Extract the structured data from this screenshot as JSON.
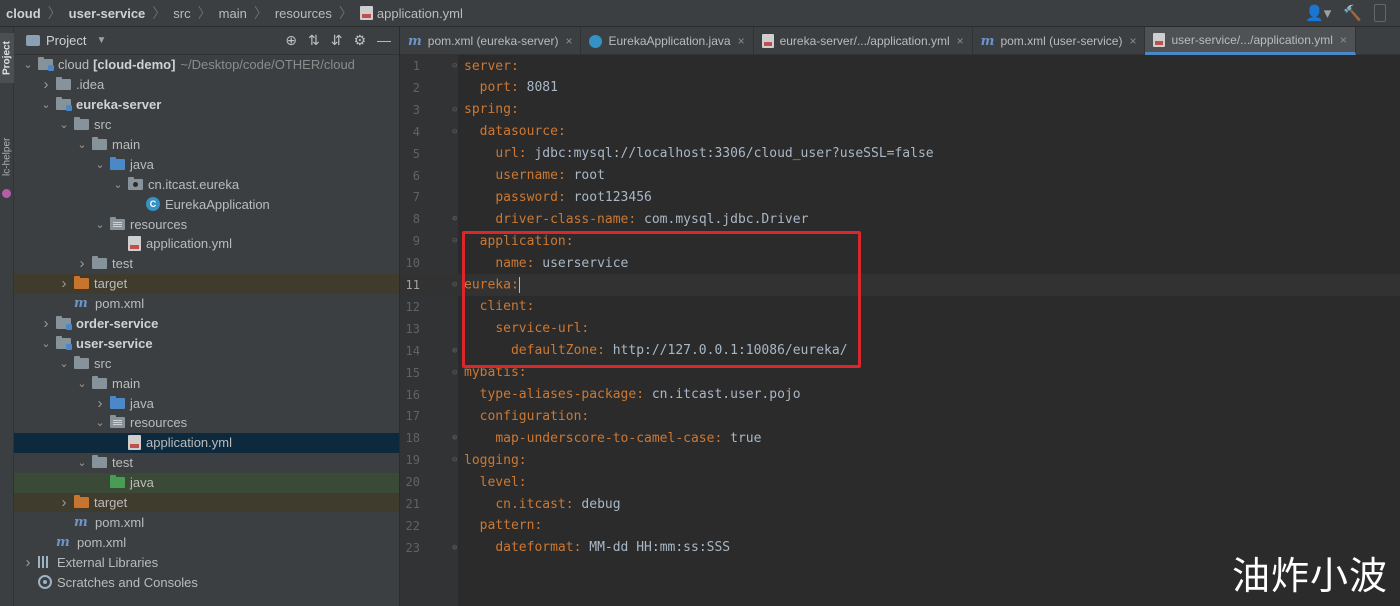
{
  "breadcrumb": [
    "cloud",
    "user-service",
    "src",
    "main",
    "resources",
    "application.yml"
  ],
  "left_strip": {
    "project_tab": "Project",
    "helper_tab": "lc-helper"
  },
  "project_panel": {
    "title": "Project",
    "tree": [
      {
        "depth": 0,
        "arrow": "open",
        "icon": "folder-module",
        "label": "cloud",
        "label_bold": "[cloud-demo]",
        "path": "~/Desktop/code/OTHER/cloud"
      },
      {
        "depth": 1,
        "arrow": "closed",
        "icon": "folder",
        "label": ".idea"
      },
      {
        "depth": 1,
        "arrow": "open",
        "icon": "folder-module",
        "label": "eureka-server",
        "bold": true
      },
      {
        "depth": 2,
        "arrow": "open",
        "icon": "folder",
        "label": "src"
      },
      {
        "depth": 3,
        "arrow": "open",
        "icon": "folder",
        "label": "main"
      },
      {
        "depth": 4,
        "arrow": "open",
        "icon": "folder-blue",
        "label": "java"
      },
      {
        "depth": 5,
        "arrow": "open",
        "icon": "folder-pkg",
        "label": "cn.itcast.eureka"
      },
      {
        "depth": 6,
        "arrow": "none",
        "icon": "class",
        "label": "EurekaApplication"
      },
      {
        "depth": 4,
        "arrow": "open",
        "icon": "folder-resources",
        "label": "resources"
      },
      {
        "depth": 5,
        "arrow": "none",
        "icon": "yml",
        "label": "application.yml"
      },
      {
        "depth": 3,
        "arrow": "closed",
        "icon": "folder",
        "label": "test"
      },
      {
        "depth": 2,
        "arrow": "closed",
        "icon": "folder-orange",
        "label": "target",
        "hl": "olive"
      },
      {
        "depth": 2,
        "arrow": "none",
        "icon": "maven",
        "label": "pom.xml"
      },
      {
        "depth": 1,
        "arrow": "closed",
        "icon": "folder-module",
        "label": "order-service",
        "bold": true
      },
      {
        "depth": 1,
        "arrow": "open",
        "icon": "folder-module",
        "label": "user-service",
        "bold": true
      },
      {
        "depth": 2,
        "arrow": "open",
        "icon": "folder",
        "label": "src"
      },
      {
        "depth": 3,
        "arrow": "open",
        "icon": "folder",
        "label": "main"
      },
      {
        "depth": 4,
        "arrow": "closed",
        "icon": "folder-blue",
        "label": "java"
      },
      {
        "depth": 4,
        "arrow": "open",
        "icon": "folder-resources",
        "label": "resources"
      },
      {
        "depth": 5,
        "arrow": "none",
        "icon": "yml",
        "label": "application.yml",
        "hl": "selected"
      },
      {
        "depth": 3,
        "arrow": "open",
        "icon": "folder",
        "label": "test"
      },
      {
        "depth": 4,
        "arrow": "none",
        "icon": "folder-green",
        "label": "java",
        "hl": "green"
      },
      {
        "depth": 2,
        "arrow": "closed",
        "icon": "folder-orange",
        "label": "target",
        "hl": "olive"
      },
      {
        "depth": 2,
        "arrow": "none",
        "icon": "maven",
        "label": "pom.xml"
      },
      {
        "depth": 1,
        "arrow": "none",
        "icon": "maven",
        "label": "pom.xml"
      },
      {
        "depth": 0,
        "arrow": "closed",
        "icon": "library",
        "label": "External Libraries"
      },
      {
        "depth": 0,
        "arrow": "none",
        "icon": "scratch",
        "label": "Scratches and Consoles"
      }
    ]
  },
  "tabs": [
    {
      "icon": "maven",
      "label": "pom.xml (eureka-server)",
      "active": false
    },
    {
      "icon": "class",
      "label": "EurekaApplication.java",
      "active": false
    },
    {
      "icon": "yml",
      "label": "eureka-server/.../application.yml",
      "active": false
    },
    {
      "icon": "maven",
      "label": "pom.xml (user-service)",
      "active": false
    },
    {
      "icon": "yml",
      "label": "user-service/.../application.yml",
      "active": true
    }
  ],
  "editor": {
    "current_line": 11,
    "lines": [
      {
        "n": "1",
        "indent": 0,
        "key": "server",
        "value": ""
      },
      {
        "n": "2",
        "indent": 1,
        "key": "port",
        "value": "8081"
      },
      {
        "n": "3",
        "indent": 0,
        "key": "spring",
        "value": ""
      },
      {
        "n": "4",
        "indent": 1,
        "key": "datasource",
        "value": ""
      },
      {
        "n": "5",
        "indent": 2,
        "key": "url",
        "value": "jdbc:mysql://localhost:3306/cloud_user?useSSL=false"
      },
      {
        "n": "6",
        "indent": 2,
        "key": "username",
        "value": "root"
      },
      {
        "n": "7",
        "indent": 2,
        "key": "password",
        "value": "root123456"
      },
      {
        "n": "8",
        "indent": 2,
        "key": "driver-class-name",
        "value": "com.mysql.jdbc.Driver"
      },
      {
        "n": "9",
        "indent": 1,
        "key": "application",
        "value": ""
      },
      {
        "n": "10",
        "indent": 2,
        "key": "name",
        "value": "userservice"
      },
      {
        "n": "11",
        "indent": 0,
        "key": "eureka",
        "value": ""
      },
      {
        "n": "12",
        "indent": 1,
        "key": "client",
        "value": ""
      },
      {
        "n": "13",
        "indent": 2,
        "key": "service-url",
        "value": ""
      },
      {
        "n": "14",
        "indent": 3,
        "key": "defaultZone",
        "value": "http://127.0.0.1:10086/eureka/"
      },
      {
        "n": "15",
        "indent": 0,
        "key": "mybatis",
        "value": ""
      },
      {
        "n": "16",
        "indent": 1,
        "key": "type-aliases-package",
        "value": "cn.itcast.user.pojo"
      },
      {
        "n": "17",
        "indent": 1,
        "key": "configuration",
        "value": ""
      },
      {
        "n": "18",
        "indent": 2,
        "key": "map-underscore-to-camel-case",
        "value": "true"
      },
      {
        "n": "19",
        "indent": 0,
        "key": "logging",
        "value": ""
      },
      {
        "n": "20",
        "indent": 1,
        "key": "level",
        "value": ""
      },
      {
        "n": "21",
        "indent": 2,
        "key": "cn.itcast",
        "value": "debug"
      },
      {
        "n": "22",
        "indent": 1,
        "key": "pattern",
        "value": ""
      },
      {
        "n": "23",
        "indent": 2,
        "key": "dateformat",
        "value": "MM-dd HH:mm:ss:SSS"
      }
    ]
  },
  "watermark": "油炸小波",
  "colors": {
    "highlight_box": "#d9272b",
    "yaml_key": "#cc7832",
    "yaml_value": "#a9b7c6",
    "selection": "#0d293e"
  }
}
